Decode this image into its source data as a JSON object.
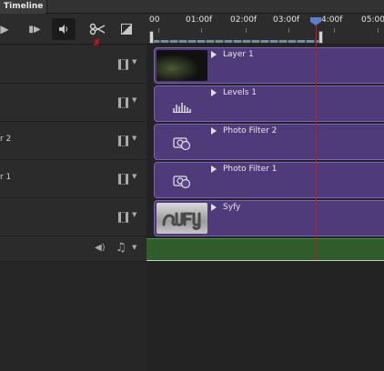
{
  "panel": {
    "title": "Timeline"
  },
  "toolbar": {
    "play_icon": "play-icon",
    "step_icon": "step-forward-icon",
    "audio_icon": "speaker-icon",
    "cut_icon": "scissors-icon",
    "mask_icon": "mask-icon"
  },
  "ruler": {
    "labels": [
      "00",
      "01:00f",
      "02:00f",
      "03:00f",
      "4:00f",
      "05:00"
    ]
  },
  "track_headers": [
    {
      "name": ""
    },
    {
      "name": ""
    },
    {
      "name": "r 2"
    },
    {
      "name": "r 1"
    },
    {
      "name": ""
    }
  ],
  "clips": [
    {
      "label": "Layer 1"
    },
    {
      "label": "Levels 1"
    },
    {
      "label": "Photo Filter 2"
    },
    {
      "label": "Photo Filter 1"
    },
    {
      "label": "Syfy"
    }
  ],
  "colors": {
    "clip_purple": "#4f3a7a",
    "audio_green": "#2f5c2b",
    "playhead_red": "#c21d1d",
    "playhead_blue": "#5b7ed0"
  }
}
